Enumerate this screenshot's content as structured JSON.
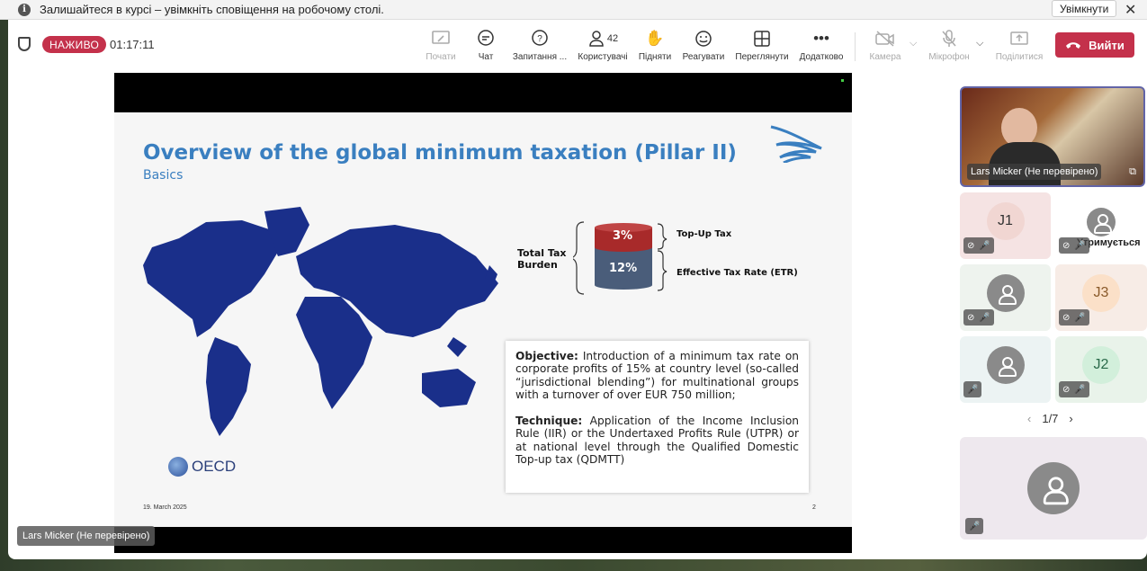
{
  "notification": {
    "text": "Залишайтеся в курсі – увімкніть сповіщення на робочому столі.",
    "enable_label": "Увімкнути"
  },
  "toolbar": {
    "live_label": "НАЖИВО",
    "timer": "01:17:11",
    "start_label": "Почати",
    "chat_label": "Чат",
    "qa_label": "Запитання ...",
    "users_label": "Користувачі",
    "users_count": "42",
    "raise_label": "Підняти",
    "react_label": "Реагувати",
    "view_label": "Переглянути",
    "more_label": "Додатково",
    "camera_label": "Камера",
    "mic_label": "Мікрофон",
    "share_label": "Поділитися",
    "leave_label": "Вийти"
  },
  "slide": {
    "title": "Overview of the global minimum taxation (Pillar II)",
    "subtitle": "Basics",
    "total_tax_label": "Total Tax Burden",
    "topup_pct": "3%",
    "etr_pct": "12%",
    "topup_label": "Top-Up Tax",
    "etr_label": "Effective Tax Rate (ETR)",
    "objective_heading": "Objective:",
    "objective_text": " Introduction of a minimum tax rate on corporate profits of 15% at country level (so-called “jurisdictional blending”) for multinational groups with a turnover of over EUR 750 million;",
    "technique_heading": "Technique:",
    "technique_text": " Application of the Income Inclusion Rule (IIR) or the Undertaxed Profits Rule (UTPR) or at national level through the Qualified Domestic Top-up tax (QDMTT)",
    "oecd_text": "OECD",
    "date": "19. March 2025",
    "page_num": "2"
  },
  "presenter_name": "Lars Micker (Не перевірено)",
  "participants": {
    "speaker_name": "Lars Micker (Не перевірено)",
    "j1": "J1",
    "j2": "J2",
    "j3": "J3",
    "hold_label": "Утримується",
    "pager": "1/7"
  },
  "colors": {
    "live": "#c4314b",
    "leave": "#c4314b",
    "title": "#3a7fc0",
    "map": "#1a2f8a"
  }
}
